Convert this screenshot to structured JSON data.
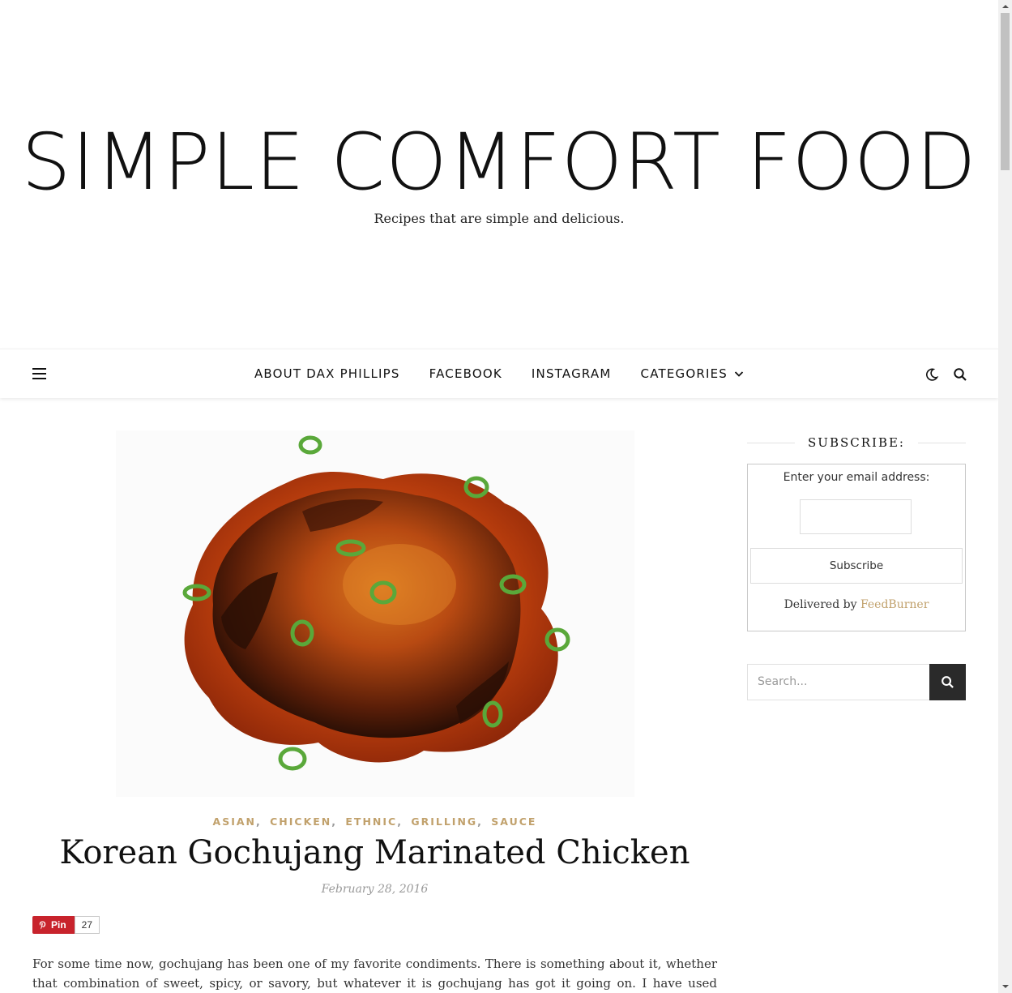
{
  "header": {
    "site_title": "SIMPLE COMFORT FOOD",
    "tagline": "Recipes that are simple and delicious."
  },
  "nav": {
    "menu_icon": "hamburger-menu-icon",
    "items": [
      {
        "label": "ABOUT DAX PHILLIPS"
      },
      {
        "label": "FACEBOOK"
      },
      {
        "label": "INSTAGRAM"
      },
      {
        "label": "CATEGORIES",
        "icon": "chevron-down-icon"
      }
    ],
    "dark_mode_icon": "moon-icon",
    "search_icon": "search-icon"
  },
  "post": {
    "image_alt": "Gochujang chicken with scallions",
    "categories": [
      "ASIAN",
      "CHICKEN",
      "ETHNIC",
      "GRILLING",
      "SAUCE"
    ],
    "title": "Korean Gochujang Marinated Chicken",
    "date": "February 28, 2016",
    "pin": {
      "label": "Pin",
      "count": "27",
      "icon": "pinterest-icon"
    },
    "excerpt": "For some time now, gochujang has been one of my favorite condiments. There is something about it, whether that combination of sweet, spicy, or savory, but whatever it is gochujang has got it going on. I have used gochujang in a couple of"
  },
  "sidebar": {
    "subscribe_title": "SUBSCRIBE:",
    "email_label": "Enter your email address:",
    "email_value": "",
    "subscribe_button": "Subscribe",
    "delivered_by": "Delivered by",
    "feedburner": "FeedBurner",
    "search_placeholder": "Search..."
  },
  "colors": {
    "accent": "#c1a16c",
    "pinterest": "#c8232c",
    "search_button": "#2a2a2a"
  }
}
